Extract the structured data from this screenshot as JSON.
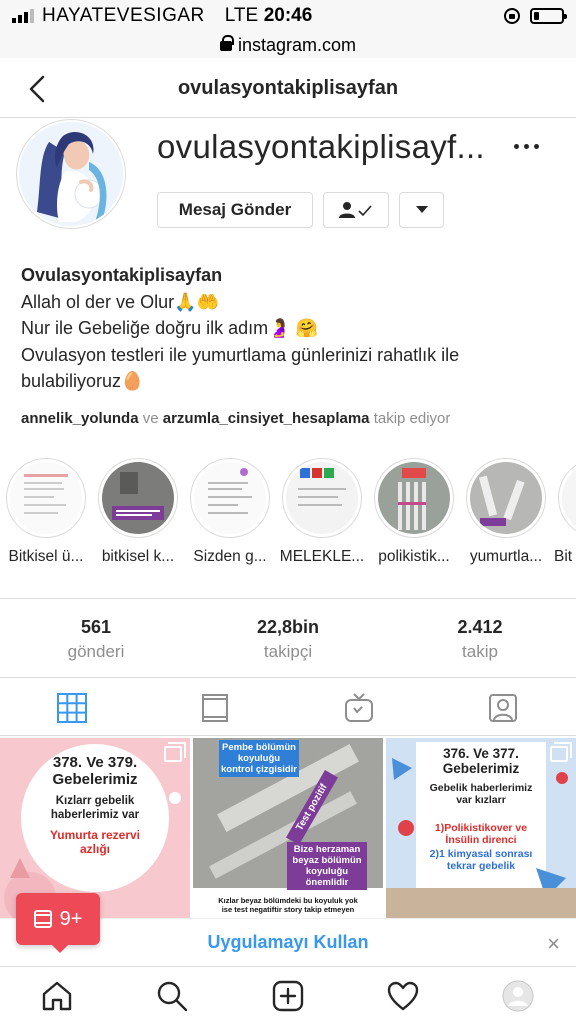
{
  "status_bar": {
    "carrier": "HAYATEVESIGAR",
    "network": "LTE",
    "time": "20:46"
  },
  "browser": {
    "url": "instagram.com"
  },
  "header": {
    "title": "ovulasyontakiplisayfan"
  },
  "profile": {
    "username": "ovulasyontakiplisayf...",
    "message_button": "Mesaj Gönder",
    "name": "Ovulasyontakiplisayfan",
    "bio_lines": [
      "Allah ol der ve Olur🙏🤲",
      "Nur ile Gebeliğe doğru ilk adım🤰 🤗",
      "Ovulasyon testleri ile yumurtlama günlerinizi rahatlık ile",
      "bulabiliyoruz🥚"
    ],
    "followed_by": {
      "user1": "annelik_yolunda",
      "connector": "ve",
      "user2": "arzumla_cinsiyet_hesaplama",
      "suffix": "takip ediyor"
    }
  },
  "highlights": [
    {
      "label": "Bitkisel ü..."
    },
    {
      "label": "bitkisel k..."
    },
    {
      "label": "Sizden g..."
    },
    {
      "label": "MELEKLE..."
    },
    {
      "label": "polikistik..."
    },
    {
      "label": "yumurtla..."
    },
    {
      "label": "Bit"
    }
  ],
  "stats": {
    "posts": {
      "value": "561",
      "label": "gönderi"
    },
    "followers": {
      "value": "22,8bin",
      "label": "takipçi"
    },
    "following": {
      "value": "2.412",
      "label": "takip"
    }
  },
  "posts": {
    "post1": {
      "title": "378. Ve 379. Gebelerimiz",
      "subtitle": "Kızlarr gebelik haberlerimiz var",
      "highlight": "Yumurta rezervi azlığı"
    },
    "post2": {
      "top": "Pembe bölümün koyuluğu kontrol çizgisidir",
      "tag": "Test pozitif",
      "middle": "Bize herzaman beyaz bölümün koyuluğu önemlidir",
      "bottom": "Kızlar beyaz bölümdeki bu koyuluk yok ise test negatiftir story takip etmeyen"
    },
    "post3": {
      "title": "376. Ve 377. Gebelerimiz",
      "subtitle": "Gebelik haberlerimiz var kızlarr",
      "item1": "1)Polikistikover ve İnsülin direnci",
      "item2": "2)1 kimyasal sonrası tekrar gebelik"
    }
  },
  "notification": {
    "count": "9+"
  },
  "app_banner": {
    "label": "Uygulamayı Kullan",
    "close": "×"
  },
  "colors": {
    "accent": "#3897f0",
    "badge": "#ed4956",
    "border": "#dbdbdb",
    "muted": "#8e8e8e"
  }
}
